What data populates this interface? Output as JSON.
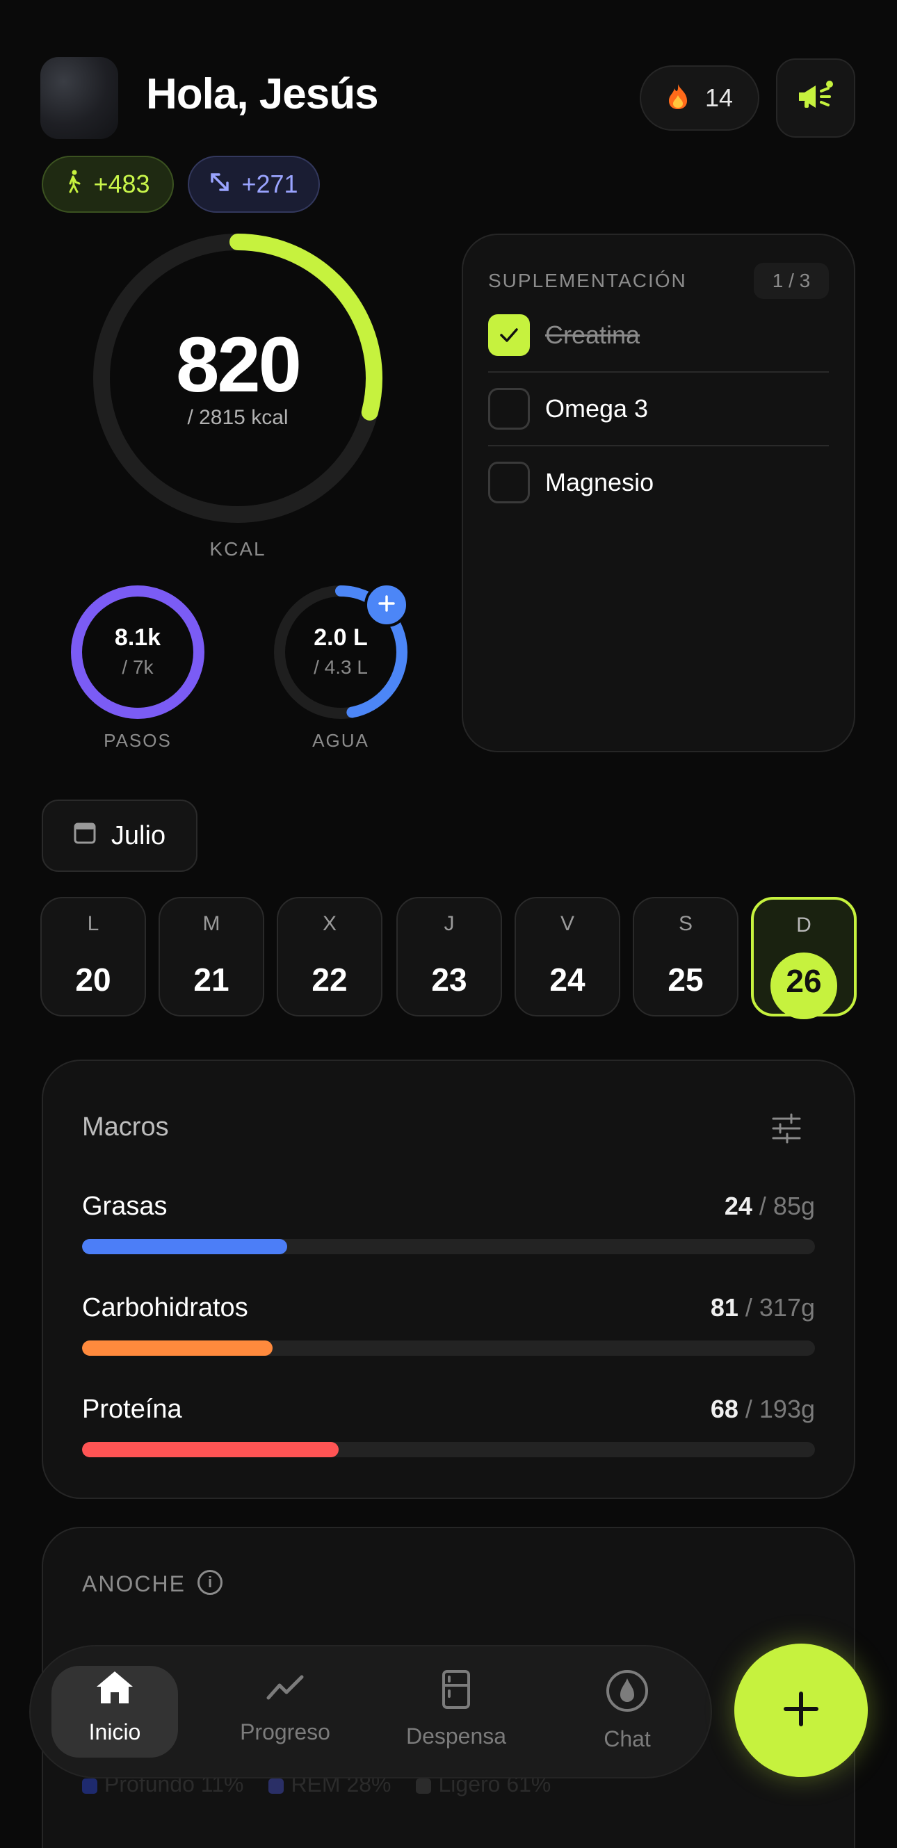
{
  "header": {
    "greeting": "Hola, Jesús",
    "streak_count": "14",
    "steps_delta": "+483",
    "distance_delta": "+271"
  },
  "calories": {
    "value": "820",
    "goal": "/ 2815 kcal",
    "label": "KCAL",
    "progress": 0.29
  },
  "steps": {
    "value": "8.1k",
    "goal": "/ 7k",
    "label": "PASOS",
    "progress": 1.0
  },
  "water": {
    "value": "2.0 L",
    "goal": "/ 4.3 L",
    "label": "AGUA",
    "progress": 0.47
  },
  "supplements": {
    "title": "SUPLEMENTACIÓN",
    "count": "1 / 3",
    "items": [
      {
        "name": "Creatina",
        "checked": true
      },
      {
        "name": "Omega 3",
        "checked": false
      },
      {
        "name": "Magnesio",
        "checked": false
      }
    ]
  },
  "month": {
    "label": "Julio"
  },
  "week": [
    {
      "letter": "L",
      "num": "20"
    },
    {
      "letter": "M",
      "num": "21"
    },
    {
      "letter": "X",
      "num": "22"
    },
    {
      "letter": "J",
      "num": "23"
    },
    {
      "letter": "V",
      "num": "24"
    },
    {
      "letter": "S",
      "num": "25"
    },
    {
      "letter": "D",
      "num": "26"
    }
  ],
  "macros": {
    "title": "Macros",
    "items": [
      {
        "name": "Grasas",
        "value": "24",
        "goal": " / 85g",
        "progress": 0.28,
        "color": "#4c7ef7"
      },
      {
        "name": "Carbohidratos",
        "value": "81",
        "goal": " / 317g",
        "progress": 0.26,
        "color": "#ff8a3d"
      },
      {
        "name": "Proteína",
        "value": "68",
        "goal": " / 193g",
        "progress": 0.35,
        "color": "#ff5454"
      }
    ]
  },
  "last_night": {
    "title": "ANOCHE",
    "legend": [
      {
        "label": "Profundo 11%",
        "color": "#1e2a6e"
      },
      {
        "label": "REM 28%",
        "color": "#2a2f66"
      },
      {
        "label": "Ligero 61%",
        "color": "#2b2b2b"
      }
    ]
  },
  "nav": {
    "items": [
      {
        "label": "Inicio",
        "icon": "home-icon"
      },
      {
        "label": "Progreso",
        "icon": "trend-icon"
      },
      {
        "label": "Despensa",
        "icon": "fridge-icon"
      },
      {
        "label": "Chat",
        "icon": "chat-icon"
      }
    ]
  },
  "colors": {
    "accent": "#c6f23e",
    "background": "#0a0a0a",
    "card": "#121212",
    "steps_ring": "#7b5cf5",
    "water_ring": "#4c86f7"
  }
}
